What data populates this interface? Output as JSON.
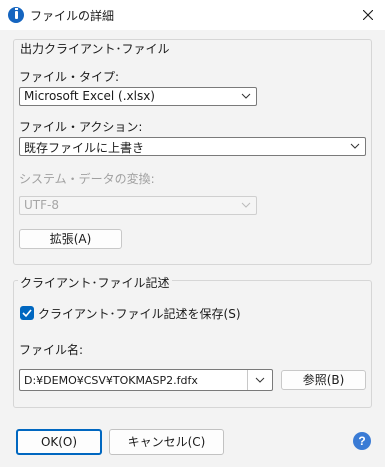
{
  "window": {
    "title": "ファイルの詳細"
  },
  "group_output": {
    "legend": "出力クライアント･ファイル",
    "file_type_label": "ファイル・タイプ:",
    "file_type_value": "Microsoft Excel (.xlsx)",
    "file_action_label": "ファイル・アクション:",
    "file_action_value": "既存ファイルに上書き",
    "encoding_label": "システム・データの変換:",
    "encoding_value": "UTF-8",
    "expand_button": "拡張(A)"
  },
  "group_desc": {
    "legend": "クライアント･ファイル記述",
    "save_checkbox_label": "クライアント･ファイル記述を保存(S)",
    "save_checked": true,
    "filename_label": "ファイル名:",
    "filename_value": "D:¥DEMO¥CSV¥TOKMASP2.fdfx",
    "browse_button": "参照(B)"
  },
  "footer": {
    "ok_button": "OK(O)",
    "cancel_button": "キャンセル(C)",
    "help_icon_glyph": "?"
  },
  "colors": {
    "accent": "#0067c0",
    "help": "#3a7bd5"
  }
}
